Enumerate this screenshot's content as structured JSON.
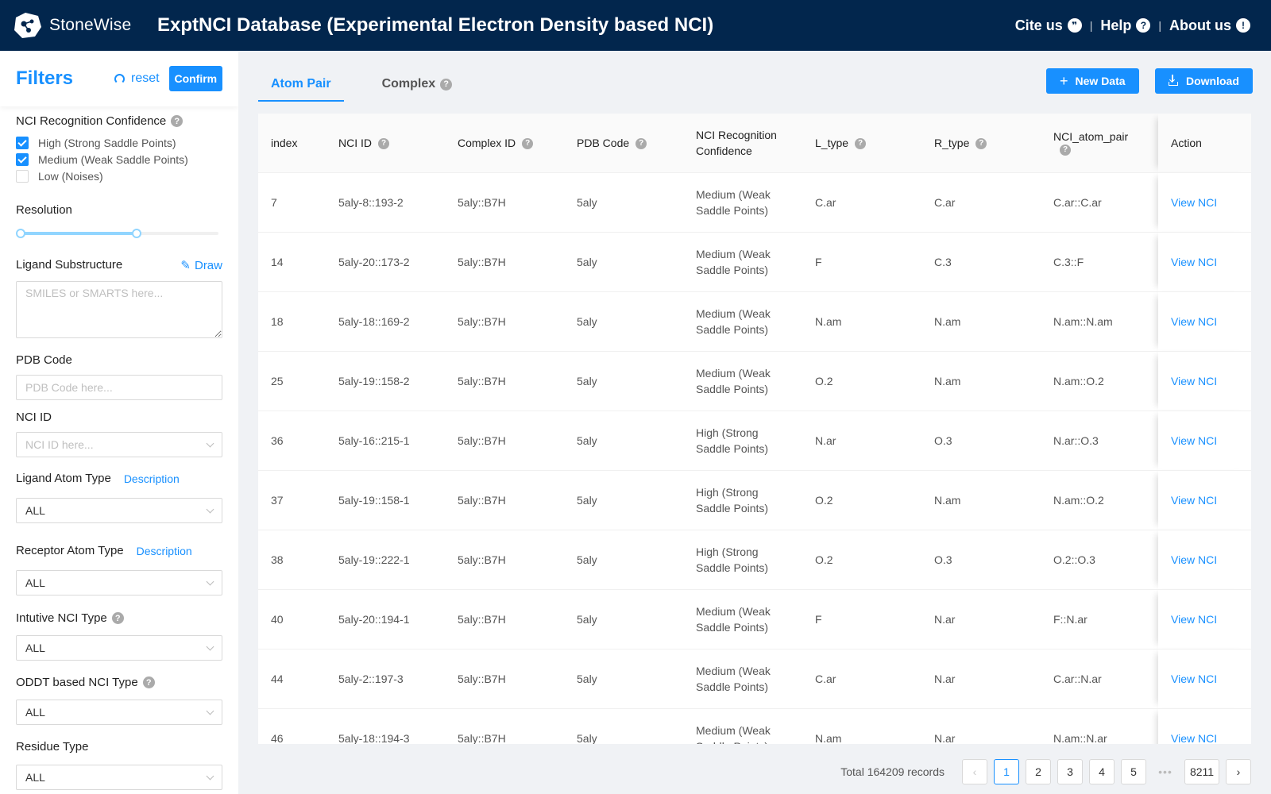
{
  "header": {
    "brand": "StoneWise",
    "title": "ExptNCI Database (Experimental Electron Density based NCI)",
    "links": [
      {
        "label": "Cite us",
        "icon": "quote-icon"
      },
      {
        "label": "Help",
        "icon": "question-icon"
      },
      {
        "label": "About us",
        "icon": "exclamation-icon"
      }
    ],
    "bg_color": "#02264d"
  },
  "sidebar": {
    "title": "Filters",
    "reset_label": "reset",
    "confirm_label": "Confirm",
    "confidence": {
      "label": "NCI Recognition Confidence",
      "options": [
        {
          "label": "High (Strong Saddle Points)",
          "checked": true
        },
        {
          "label": "Medium (Weak Saddle Points)",
          "checked": true
        },
        {
          "label": "Low (Noises)",
          "checked": false
        }
      ]
    },
    "resolution": {
      "label": "Resolution",
      "low": 0,
      "high": 0.58
    },
    "ligand_substructure": {
      "label": "Ligand Substructure",
      "draw_label": "Draw",
      "placeholder": "SMILES or SMARTS here..."
    },
    "pdb_code": {
      "label": "PDB Code",
      "placeholder": "PDB Code here..."
    },
    "nci_id": {
      "label": "NCI ID",
      "placeholder": "NCI ID here..."
    },
    "ligand_atom_type": {
      "label": "Ligand Atom Type",
      "desc": "Description",
      "value": "ALL"
    },
    "receptor_atom_type": {
      "label": "Receptor Atom Type",
      "desc": "Description",
      "value": "ALL"
    },
    "intuitive_nci_type": {
      "label": "Intutive NCI Type",
      "value": "ALL"
    },
    "oddt_nci_type": {
      "label": "ODDT based NCI Type",
      "value": "ALL"
    },
    "residue_type": {
      "label": "Residue Type",
      "value": "ALL"
    }
  },
  "main": {
    "tabs": [
      {
        "label": "Atom Pair",
        "active": true
      },
      {
        "label": "Complex",
        "active": false
      }
    ],
    "new_data_label": "New Data",
    "download_label": "Download",
    "accent": "#1890ff",
    "columns": [
      "index",
      "NCI ID",
      "Complex ID",
      "PDB Code",
      "NCI Recognition Confidence",
      "L_type",
      "R_type",
      "NCI_atom_pair",
      "Action"
    ],
    "rows": [
      {
        "index": "7",
        "nci_id": "5aly-8::193-2",
        "complex_id": "5aly::B7H",
        "pdb": "5aly",
        "confidence": "Medium (Weak Saddle Points)",
        "l_type": "C.ar",
        "r_type": "C.ar",
        "pair": "C.ar::C.ar",
        "action": "View NCI"
      },
      {
        "index": "14",
        "nci_id": "5aly-20::173-2",
        "complex_id": "5aly::B7H",
        "pdb": "5aly",
        "confidence": "Medium (Weak Saddle Points)",
        "l_type": "F",
        "r_type": "C.3",
        "pair": "C.3::F",
        "action": "View NCI"
      },
      {
        "index": "18",
        "nci_id": "5aly-18::169-2",
        "complex_id": "5aly::B7H",
        "pdb": "5aly",
        "confidence": "Medium (Weak Saddle Points)",
        "l_type": "N.am",
        "r_type": "N.am",
        "pair": "N.am::N.am",
        "action": "View NCI"
      },
      {
        "index": "25",
        "nci_id": "5aly-19::158-2",
        "complex_id": "5aly::B7H",
        "pdb": "5aly",
        "confidence": "Medium (Weak Saddle Points)",
        "l_type": "O.2",
        "r_type": "N.am",
        "pair": "N.am::O.2",
        "action": "View NCI"
      },
      {
        "index": "36",
        "nci_id": "5aly-16::215-1",
        "complex_id": "5aly::B7H",
        "pdb": "5aly",
        "confidence": "High (Strong Saddle Points)",
        "l_type": "N.ar",
        "r_type": "O.3",
        "pair": "N.ar::O.3",
        "action": "View NCI"
      },
      {
        "index": "37",
        "nci_id": "5aly-19::158-1",
        "complex_id": "5aly::B7H",
        "pdb": "5aly",
        "confidence": "High (Strong Saddle Points)",
        "l_type": "O.2",
        "r_type": "N.am",
        "pair": "N.am::O.2",
        "action": "View NCI"
      },
      {
        "index": "38",
        "nci_id": "5aly-19::222-1",
        "complex_id": "5aly::B7H",
        "pdb": "5aly",
        "confidence": "High (Strong Saddle Points)",
        "l_type": "O.2",
        "r_type": "O.3",
        "pair": "O.2::O.3",
        "action": "View NCI"
      },
      {
        "index": "40",
        "nci_id": "5aly-20::194-1",
        "complex_id": "5aly::B7H",
        "pdb": "5aly",
        "confidence": "Medium (Weak Saddle Points)",
        "l_type": "F",
        "r_type": "N.ar",
        "pair": "F::N.ar",
        "action": "View NCI"
      },
      {
        "index": "44",
        "nci_id": "5aly-2::197-3",
        "complex_id": "5aly::B7H",
        "pdb": "5aly",
        "confidence": "Medium (Weak Saddle Points)",
        "l_type": "C.ar",
        "r_type": "N.ar",
        "pair": "C.ar::N.ar",
        "action": "View NCI"
      },
      {
        "index": "46",
        "nci_id": "5aly-18::194-3",
        "complex_id": "5aly::B7H",
        "pdb": "5aly",
        "confidence": "Medium (Weak Saddle Points)",
        "l_type": "N.am",
        "r_type": "N.ar",
        "pair": "N.am::N.ar",
        "action": "View NCI"
      }
    ],
    "pagination": {
      "total_text": "Total 164209 records",
      "pages": [
        "1",
        "2",
        "3",
        "4",
        "5"
      ],
      "ellipsis": "•••",
      "last_page": "8211",
      "current": "1"
    }
  }
}
